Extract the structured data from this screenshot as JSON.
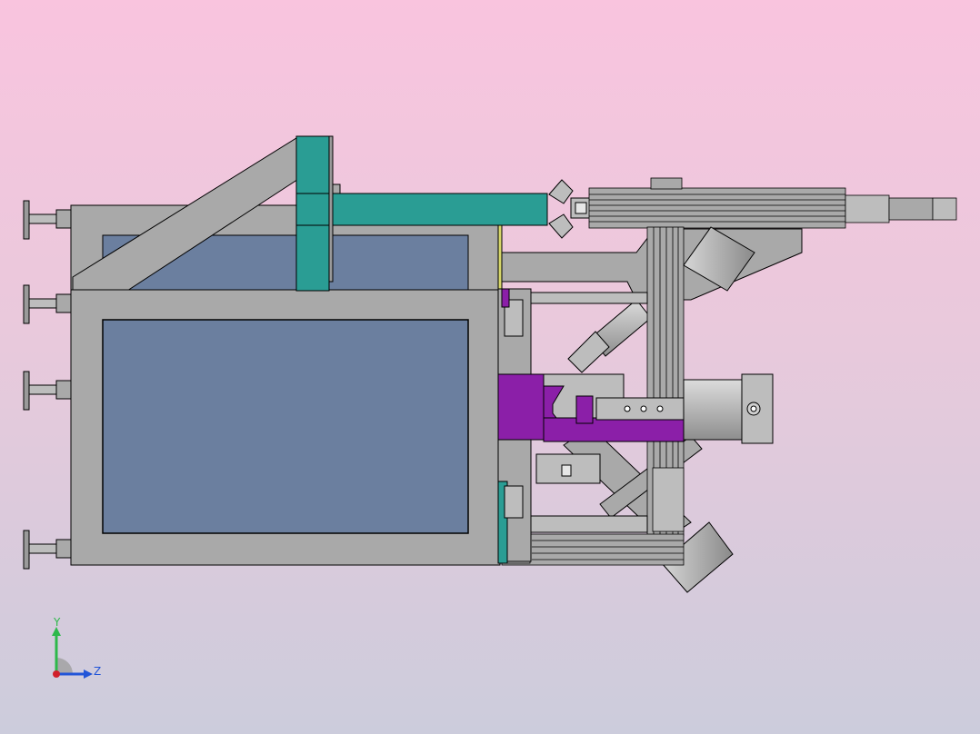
{
  "viewport": {
    "background_top": "#f9c4de",
    "background_bottom": "#ccccdc"
  },
  "model": {
    "colors": {
      "frame": "#a9a9a9",
      "panel": "#6b7f9f",
      "gantry": "#2a9d94",
      "clamp": "#8b1fa8",
      "outline": "#000000"
    }
  },
  "triad": {
    "y_label": "Y",
    "z_label": "Z",
    "y_color": "#2db84a",
    "z_color": "#2255d8",
    "origin_color": "#d11f2a"
  }
}
